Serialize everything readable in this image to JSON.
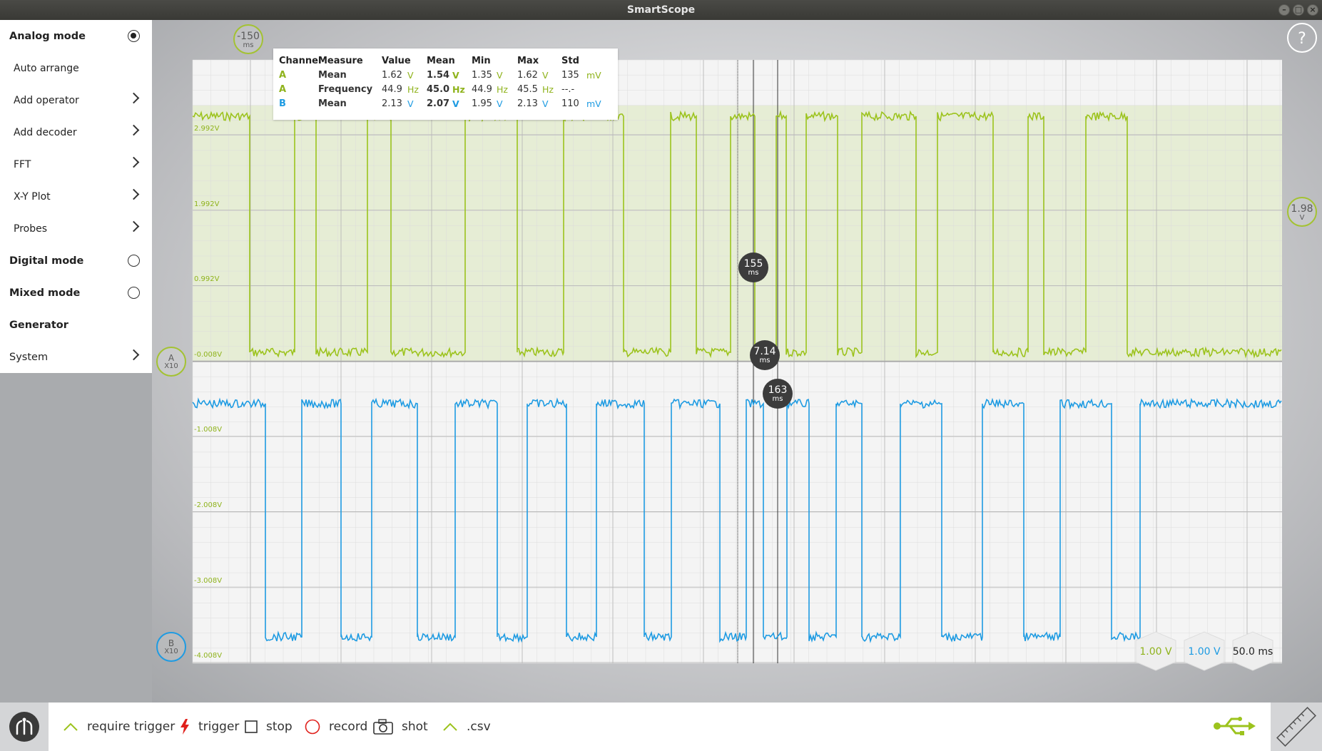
{
  "window": {
    "title": "SmartScope"
  },
  "sidebar": {
    "items": [
      {
        "label": "Analog mode",
        "kind": "radio",
        "checked": true
      },
      {
        "label": "Auto arrange",
        "kind": "plain"
      },
      {
        "label": "Add operator",
        "kind": "submenu"
      },
      {
        "label": "Add decoder",
        "kind": "submenu"
      },
      {
        "label": "FFT",
        "kind": "submenu"
      },
      {
        "label": "X-Y Plot",
        "kind": "submenu"
      },
      {
        "label": "Probes",
        "kind": "submenu"
      },
      {
        "label": "Digital mode",
        "kind": "radio",
        "checked": false
      },
      {
        "label": "Mixed mode",
        "kind": "radio",
        "checked": false
      },
      {
        "label": "Generator",
        "kind": "header"
      },
      {
        "label": "System",
        "kind": "submenu"
      }
    ]
  },
  "measurements": {
    "headers": [
      "Channel",
      "Measure",
      "Value",
      "Mean",
      "Min",
      "Max",
      "Std"
    ],
    "rows": [
      {
        "channel": "A",
        "measure": "Mean",
        "value": "1.62",
        "value_unit": "V",
        "mean": "1.54",
        "mean_unit": "V",
        "min": "1.35",
        "min_unit": "V",
        "max": "1.62",
        "max_unit": "V",
        "std": "135",
        "std_unit": "mV"
      },
      {
        "channel": "A",
        "measure": "Frequency",
        "value": "44.9",
        "value_unit": "Hz",
        "mean": "45.0",
        "mean_unit": "Hz",
        "min": "44.9",
        "min_unit": "Hz",
        "max": "45.5",
        "max_unit": "Hz",
        "std": "--.-",
        "std_unit": ""
      },
      {
        "channel": "B",
        "measure": "Mean",
        "value": "2.13",
        "value_unit": "V",
        "mean": "2.07",
        "mean_unit": "V",
        "min": "1.95",
        "min_unit": "V",
        "max": "2.13",
        "max_unit": "V",
        "std": "110",
        "std_unit": "mV"
      }
    ]
  },
  "axis": {
    "a_labels": [
      "2.992V",
      "1.992V",
      "0.992V",
      "-0.008V"
    ],
    "b_labels": [
      "-1.008V",
      "-2.008V",
      "-3.008V",
      "-4.008V"
    ]
  },
  "markers": {
    "trigger_time": {
      "value": "-150",
      "unit": "ms"
    },
    "trigger_level": {
      "value": "1.98",
      "unit": "V"
    },
    "cursor1": {
      "value": "155",
      "unit": "ms"
    },
    "cursor_delta": {
      "value": "7.14",
      "unit": "ms"
    },
    "cursor2": {
      "value": "163",
      "unit": "ms"
    },
    "channel_a": {
      "name": "A",
      "probe": "X10"
    },
    "channel_b": {
      "name": "B",
      "probe": "X10"
    }
  },
  "scale": {
    "a_volts_div": "1.00 V",
    "b_volts_div": "1.00 V",
    "time_div": "50.0 ms"
  },
  "toolbar": {
    "require_trigger": "require trigger",
    "trigger": "trigger",
    "stop": "stop",
    "record": "record",
    "shot": "shot",
    "csv": ".csv"
  },
  "help": {
    "label": "?"
  },
  "colors": {
    "channel_a": "#8fb31c",
    "channel_b": "#1e9be2",
    "trigger": "#e0201b",
    "record": "#e0201b"
  }
}
